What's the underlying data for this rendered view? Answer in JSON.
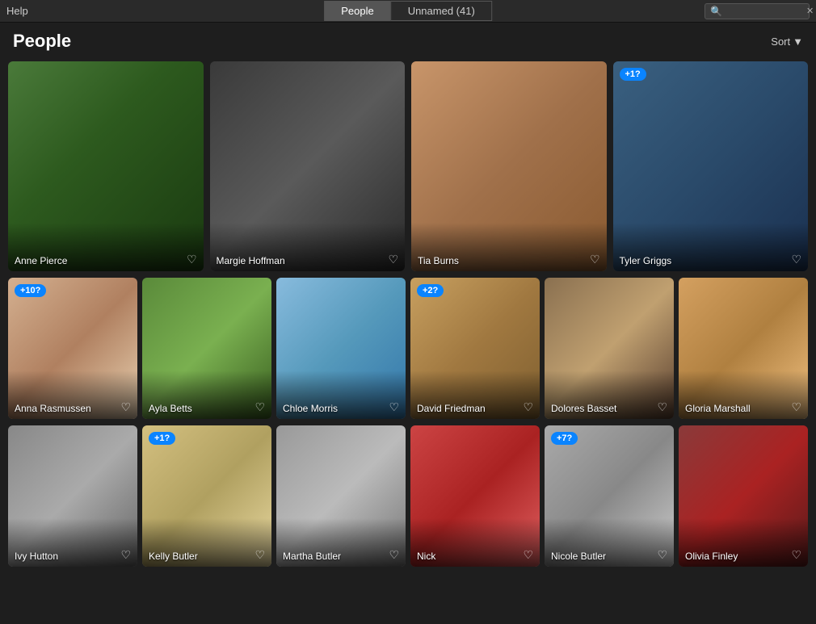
{
  "topbar": {
    "help_label": "Help",
    "tabs": [
      {
        "id": "people",
        "label": "People",
        "active": true
      },
      {
        "id": "unnamed",
        "label": "Unnamed (41)",
        "active": false
      }
    ],
    "search_placeholder": ""
  },
  "header": {
    "title": "People",
    "sort_label": "Sort"
  },
  "large_cards": [
    {
      "id": "anne-pierce",
      "name": "Anne Pierce",
      "badge": null,
      "photo_class": "photo-anne"
    },
    {
      "id": "margie-hoffman",
      "name": "Margie Hoffman",
      "badge": null,
      "photo_class": "photo-margie"
    },
    {
      "id": "tia-burns",
      "name": "Tia Burns",
      "badge": null,
      "photo_class": "photo-tia"
    },
    {
      "id": "tyler-griggs",
      "name": "Tyler Griggs",
      "badge": "+1?",
      "photo_class": "photo-tyler"
    }
  ],
  "medium_cards": [
    {
      "id": "anna-rasmussen",
      "name": "Anna Rasmussen",
      "badge": "+10?",
      "photo_class": "photo-anna"
    },
    {
      "id": "ayla-betts",
      "name": "Ayla Betts",
      "badge": null,
      "photo_class": "photo-ayla"
    },
    {
      "id": "chloe-morris",
      "name": "Chloe Morris",
      "badge": null,
      "photo_class": "photo-chloe"
    },
    {
      "id": "david-friedman",
      "name": "David Friedman",
      "badge": "+2?",
      "photo_class": "photo-david"
    },
    {
      "id": "dolores-basset",
      "name": "Dolores Basset",
      "badge": null,
      "photo_class": "photo-dolores"
    },
    {
      "id": "gloria-marshall",
      "name": "Gloria Marshall",
      "badge": null,
      "photo_class": "photo-gloria"
    }
  ],
  "bottom_cards": [
    {
      "id": "ivy-hutton",
      "name": "Ivy Hutton",
      "badge": null,
      "photo_class": "photo-ivy"
    },
    {
      "id": "kelly-butler",
      "name": "Kelly Butler",
      "badge": "+1?",
      "photo_class": "photo-kelly"
    },
    {
      "id": "martha-butler",
      "name": "Martha Butler",
      "badge": null,
      "photo_class": "photo-martha"
    },
    {
      "id": "nick",
      "name": "Nick",
      "badge": null,
      "photo_class": "photo-nick"
    },
    {
      "id": "nicole-butler",
      "name": "Nicole Butler",
      "badge": "+7?",
      "photo_class": "photo-nicole"
    },
    {
      "id": "olivia-finley",
      "name": "Olivia Finley",
      "badge": null,
      "photo_class": "photo-olivia"
    }
  ],
  "icons": {
    "heart": "♡",
    "heart_filled": "♥",
    "search": "🔍",
    "chevron_down": "▾",
    "close": "✕"
  }
}
